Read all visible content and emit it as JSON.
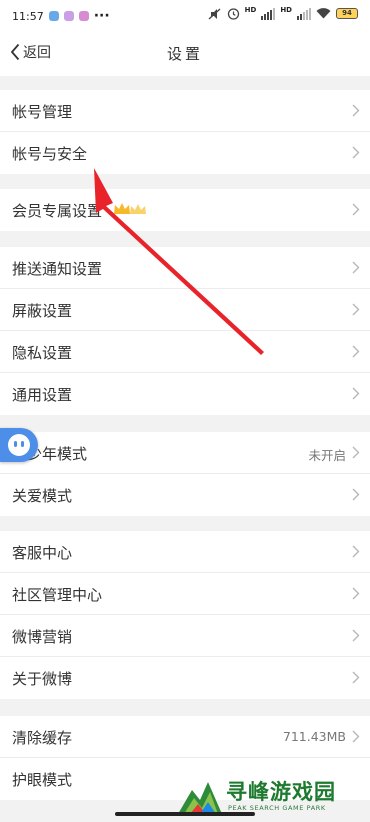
{
  "status_bar": {
    "time": "11:57",
    "dots": "···",
    "hd1": "HD",
    "hd2": "HD",
    "battery": "94"
  },
  "header": {
    "back_label": "返回",
    "title": "设置"
  },
  "groups": [
    {
      "items": [
        {
          "label": "帐号管理"
        },
        {
          "label": "帐号与安全"
        }
      ]
    },
    {
      "items": [
        {
          "label": "会员专属设置"
        }
      ]
    },
    {
      "items": [
        {
          "label": "推送通知设置"
        },
        {
          "label": "屏蔽设置"
        },
        {
          "label": "隐私设置"
        },
        {
          "label": "通用设置"
        }
      ]
    },
    {
      "items": [
        {
          "label": "青少年模式",
          "value": "未开启"
        },
        {
          "label": "关爱模式"
        }
      ]
    },
    {
      "items": [
        {
          "label": "客服中心"
        },
        {
          "label": "社区管理中心"
        },
        {
          "label": "微博营销"
        },
        {
          "label": "关于微博"
        }
      ]
    },
    {
      "items": [
        {
          "label": "清除缓存",
          "value": "711.43MB"
        },
        {
          "label": "护眼模式"
        }
      ]
    }
  ],
  "watermark": {
    "title": "寻峰游戏园",
    "subtitle": "PEAK SEARCH GAME PARK"
  },
  "colors": {
    "annotation_arrow": "#e8232a",
    "float_button": "#4d8fe8",
    "crown": "#f5b92a"
  }
}
